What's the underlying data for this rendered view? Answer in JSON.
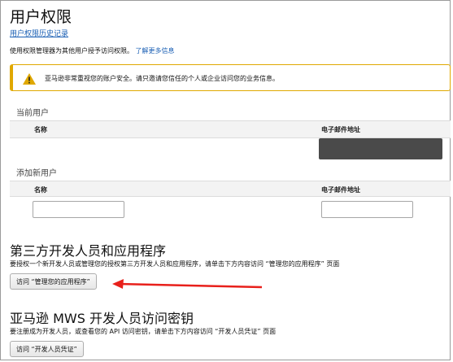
{
  "page": {
    "title": "用户权限",
    "history_link": "用户权限历史记录",
    "intro_text": "使用权限管理器为其他用户授予访问权限。",
    "learn_more": "了解更多信息"
  },
  "alert": {
    "icon": "warning-icon",
    "text": "亚马逊非常重视您的账户安全。请只邀请您信任的个人或企业访问您的业务信息。",
    "accent_color": "#e0a800"
  },
  "current_users": {
    "label": "当前用户",
    "col_name": "名称",
    "col_email": "电子邮件地址"
  },
  "add_user": {
    "label": "添加新用户",
    "col_name": "名称",
    "col_email": "电子邮件地址",
    "name_value": "",
    "email_value": ""
  },
  "third_party": {
    "heading": "第三方开发人员和应用程序",
    "description": "要授权一个新开发人员或管理您的授权第三方开发人员和应用程序，请单击下方内容访问 “管理您的应用程序” 页面",
    "button": "访问 “管理您的应用程序”"
  },
  "mws": {
    "heading": "亚马逊 MWS 开发人员访问密钥",
    "description": "要注册成为开发人员，或查看您的 API 访问密钥，请单击下方内容访问 “开发人员凭证” 页面",
    "button": "访问 “开发人员凭证”"
  },
  "annotation": {
    "arrow_color": "#e8201b"
  }
}
